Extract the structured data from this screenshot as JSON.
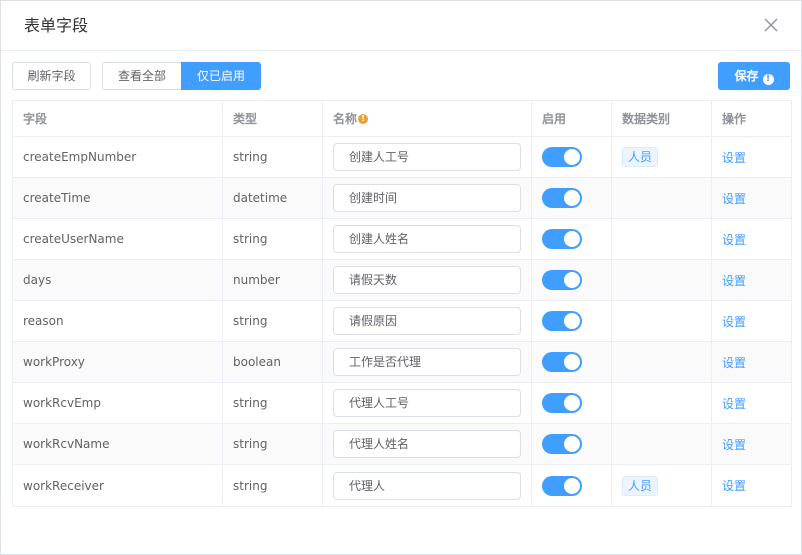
{
  "dialog": {
    "title": "表单字段",
    "close_icon": "close-icon"
  },
  "toolbar": {
    "refresh_label": "刷新字段",
    "view_all_label": "查看全部",
    "enabled_only_label": "仅已启用",
    "save_label": "保存",
    "save_info_icon": "!"
  },
  "table": {
    "headers": {
      "field": "字段",
      "type": "类型",
      "name": "名称",
      "name_info": "!",
      "enabled": "启用",
      "data_category": "数据类别",
      "action": "操作"
    },
    "rows": [
      {
        "field": "createEmpNumber",
        "type": "string",
        "name": "创建人工号",
        "enabled": true,
        "category": "人员",
        "action": "设置"
      },
      {
        "field": "createTime",
        "type": "datetime",
        "name": "创建时间",
        "enabled": true,
        "category": "",
        "action": "设置"
      },
      {
        "field": "createUserName",
        "type": "string",
        "name": "创建人姓名",
        "enabled": true,
        "category": "",
        "action": "设置"
      },
      {
        "field": "days",
        "type": "number",
        "name": "请假天数",
        "enabled": true,
        "category": "",
        "action": "设置"
      },
      {
        "field": "reason",
        "type": "string",
        "name": "请假原因",
        "enabled": true,
        "category": "",
        "action": "设置"
      },
      {
        "field": "workProxy",
        "type": "boolean",
        "name": "工作是否代理",
        "enabled": true,
        "category": "",
        "action": "设置"
      },
      {
        "field": "workRcvEmp",
        "type": "string",
        "name": "代理人工号",
        "enabled": true,
        "category": "",
        "action": "设置"
      },
      {
        "field": "workRcvName",
        "type": "string",
        "name": "代理人姓名",
        "enabled": true,
        "category": "",
        "action": "设置"
      },
      {
        "field": "workReceiver",
        "type": "string",
        "name": "代理人",
        "enabled": true,
        "category": "人员",
        "action": "设置"
      }
    ]
  },
  "colors": {
    "accent": "#409eff",
    "info_dot": "#e6a23c"
  }
}
